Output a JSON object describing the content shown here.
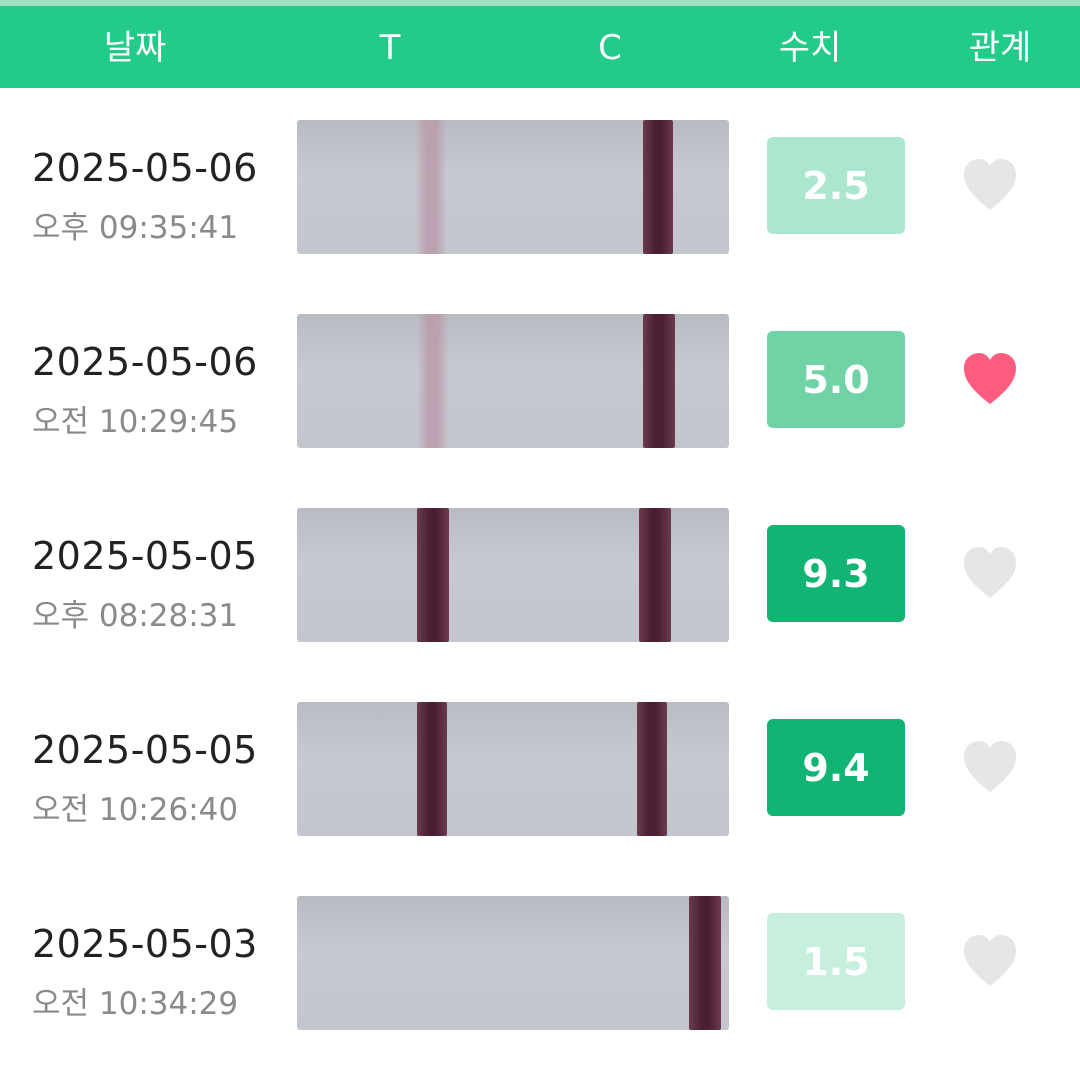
{
  "header": {
    "date_label": "날짜",
    "t_label": "T",
    "c_label": "C",
    "value_label": "수치",
    "relation_label": "관계"
  },
  "colors": {
    "header_bg": "#22cc88",
    "heart_active": "#fe5c7f",
    "heart_inactive": "#e6e6e6"
  },
  "rows": [
    {
      "date": "2025-05-06",
      "time": "오후 09:35:41",
      "value": "2.5",
      "value_color": "#abe7ce",
      "relation": false,
      "t_line": "faint",
      "c_line": "strong"
    },
    {
      "date": "2025-05-06",
      "time": "오전 10:29:45",
      "value": "5.0",
      "value_color": "#6fd3a6",
      "relation": true,
      "t_line": "faint",
      "c_line": "strong"
    },
    {
      "date": "2025-05-05",
      "time": "오후 08:28:31",
      "value": "9.3",
      "value_color": "#11b472",
      "relation": false,
      "t_line": "strong",
      "c_line": "strong"
    },
    {
      "date": "2025-05-05",
      "time": "오전 10:26:40",
      "value": "9.4",
      "value_color": "#11b472",
      "relation": false,
      "t_line": "strong",
      "c_line": "strong"
    },
    {
      "date": "2025-05-03",
      "time": "오전 10:34:29",
      "value": "1.5",
      "value_color": "#c7efdd",
      "relation": false,
      "t_line": "none",
      "c_line": "strong"
    }
  ]
}
